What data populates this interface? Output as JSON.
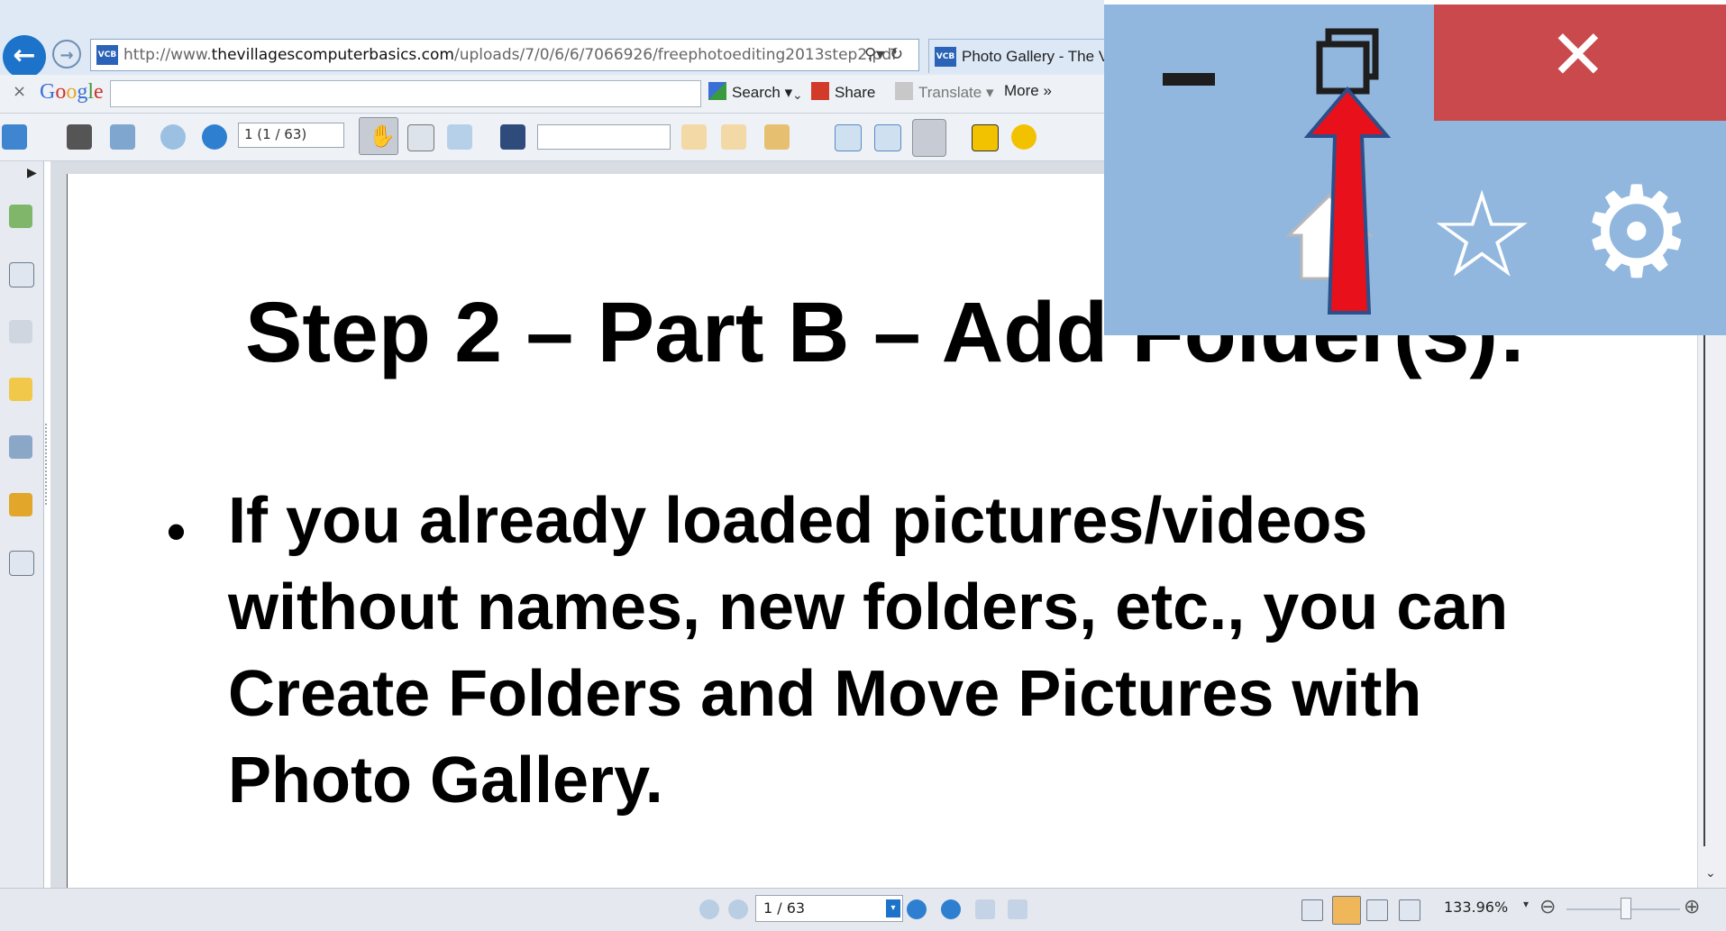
{
  "browser": {
    "url": "http://www.thevillagescomputerbasics.com/uploads/7/0/6/6/7066926/freephotoediting2013step2.pdf",
    "url_prefix": "http://www.",
    "url_domain": "thevillagescomputerbasics.com",
    "url_path": "/uploads/7/0/6/6/7066926/freephotoediting2013step2.pdf",
    "favicon_text": "VCB",
    "tab_title": "Photo Gallery - The V",
    "back_icon": "back-arrow-icon",
    "forward_icon": "forward-arrow-icon"
  },
  "google_toolbar": {
    "close": "×",
    "logo": "Google",
    "search_value": "",
    "search_label": "Search",
    "share_label": "Share",
    "translate_label": "Translate",
    "more_label": "More »"
  },
  "pdf_toolbar": {
    "page_field": "1 (1 / 63)",
    "find_value": ""
  },
  "document": {
    "title": "Step 2 – Part B – Add Folder(s):",
    "bullet": "•",
    "body": "If you already loaded pictures/videos without names, new folders, etc., you can Create Folders and Move Pictures with Photo Gallery."
  },
  "status_bar": {
    "page_field": "1 / 63",
    "zoom": "133.96%"
  },
  "overlay": {
    "minimize_icon": "minimize-icon",
    "restore_icon": "restore-icon",
    "close_label": "✕",
    "star": "☆",
    "gear": "⚙",
    "arrow_color": "#e8101a",
    "close_color": "#c9494c",
    "background_color": "#92b7de"
  }
}
